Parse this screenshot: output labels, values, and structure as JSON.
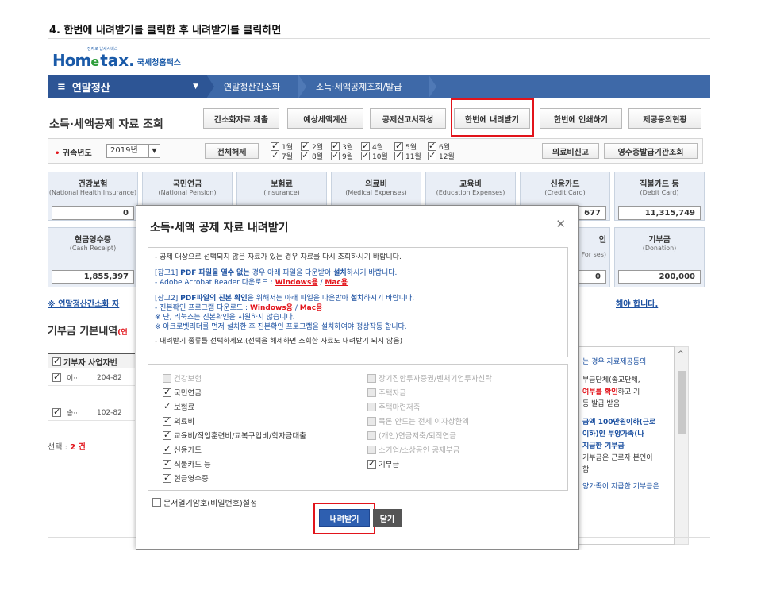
{
  "step_title": "4. 한번에 내려받기를 클릭한 후 내려받기를 클릭하면",
  "logo": {
    "home": "Hom",
    "e": "e",
    "tax": "tax.",
    "kr": "국세청홈택스",
    "small": "전자로 납세서비스"
  },
  "nav": {
    "menu_icon": "≡",
    "main": "연말정산",
    "dropdown_icon": "▼",
    "crumbs": [
      "연말정산간소화",
      "소득·세액공제조회/발급"
    ]
  },
  "page_title": "소득·세액공제 자료 조회",
  "toolbar": [
    "간소화자료 제출",
    "예상세액계산",
    "공제신고서작성",
    "한번에 내려받기",
    "한번에 인쇄하기",
    "제공동의현황"
  ],
  "filter": {
    "label_star": "•",
    "label": "귀속년도",
    "year": "2019년",
    "arrow": "▼",
    "clear_all": "전체해제",
    "months_top": [
      "1월",
      "2월",
      "3월",
      "4월",
      "5월",
      "6월"
    ],
    "months_bottom": [
      "7월",
      "8월",
      "9월",
      "10월",
      "11월",
      "12월"
    ],
    "medical_report": "의료비신고",
    "receipt_lookup": "영수증발급기관조회"
  },
  "cards_row1": [
    {
      "title": "건강보험",
      "sub": "(National Health Insurance)",
      "value": "0"
    },
    {
      "title": "국민연금",
      "sub": "(National Pension)",
      "value": ""
    },
    {
      "title": "보험료",
      "sub": "(Insurance)",
      "value": ""
    },
    {
      "title": "의료비",
      "sub": "(Medical Expenses)",
      "value": ""
    },
    {
      "title": "교육비",
      "sub": "(Education Expenses)",
      "value": ""
    },
    {
      "title": "신용카드",
      "sub": "(Credit Card)",
      "value": "677"
    },
    {
      "title": "직불카드 등",
      "sub": "(Debit Card)",
      "value": "11,315,749"
    }
  ],
  "cards_row2": [
    {
      "title": "현금영수증",
      "sub": "(Cash Receipt)",
      "value": "1,855,397"
    },
    {
      "title": "인",
      "sub": "For ses)",
      "value": "0"
    },
    {
      "title": "기부금",
      "sub": "(Donation)",
      "value": "200,000"
    }
  ],
  "note_link": "※ 연말정산간소화 자",
  "note_link_right": "해야 합니다.",
  "donation": {
    "title": "기부금 기본내역",
    "title_red": "(연",
    "header": "기부자 사업자번",
    "rows": [
      {
        "name": "이···",
        "biz": "204-82"
      },
      {
        "name": "송···",
        "biz": "102-82"
      }
    ],
    "selected_label": "선택 : ",
    "selected_count": "2 건"
  },
  "side_notes": {
    "l1": "는 경우 자료제공동의",
    "l2": "부금단체(종교단체,",
    "l3a": "여부를 확인",
    "l3b": "하고 기",
    "l4": "등 발급 받음",
    "l5": "금액 100만원이하(근로",
    "l6": "이하)인 부양가족(나",
    "l7": "지급한 기부금",
    "l8": "기부금은 근로자 본인이",
    "l9": "함",
    "l10": "양가족이 지급한 기부금은",
    "up_icon": "^"
  },
  "modal": {
    "title": "소득·세액 공제 자료 내려받기",
    "close_icon": "✕",
    "info": {
      "l1": "- 공제 대상으로 선택되지 않은 자료가 있는 경우 자료를 다시 조회하시기 바랍니다.",
      "n1a": "[참고1] ",
      "n1b": "PDF 파일을 열수 없는",
      "n1c": " 경우  아래 파일을 다운받아 ",
      "n1d": "설치",
      "n1e": "하시기 바랍니다.",
      "n2a": "- Adobe Acrobat Reader 다운로드 : ",
      "n2b": "Windows용",
      "n2c": " / ",
      "n2d": "Mac용",
      "n3a": "[참고2] ",
      "n3b": "PDF파일의 진본 확인",
      "n3c": "을 위해서는 아래 파일을 다운받아 ",
      "n3d": "설치",
      "n3e": "하시기 바랍니다.",
      "n4a": "- 진본확인 프로그램 다운로드 : ",
      "n4b": "Windows용",
      "n4c": " / ",
      "n4d": "Mac용",
      "n5": "※ 단, 리눅스는 진본확인을 지원하지 않습니다.",
      "n6": "※ 아크로벳리더를 먼저 설치한 후 진본확인 프로그램을 설치하여야 정상작동 합니다.",
      "l2": "- 내려받기 종류를 선택하세요.(선택을 해제하면 조회한 자료도 내려받기 되지 않음)"
    },
    "left_options": [
      {
        "label": "건강보험",
        "checked": false,
        "disabled": true
      },
      {
        "label": "국민연금",
        "checked": true,
        "disabled": false
      },
      {
        "label": "보험료",
        "checked": true,
        "disabled": false
      },
      {
        "label": "의료비",
        "checked": true,
        "disabled": false
      },
      {
        "label": "교육비/직업훈련비/교복구입비/학자금대출",
        "checked": true,
        "disabled": false
      },
      {
        "label": "신용카드",
        "checked": true,
        "disabled": false
      },
      {
        "label": "직불카드 등",
        "checked": true,
        "disabled": false
      },
      {
        "label": "현금영수증",
        "checked": true,
        "disabled": false
      }
    ],
    "right_options": [
      {
        "label": "장기집합투자증권/벤처기업투자신탁",
        "checked": false,
        "disabled": true
      },
      {
        "label": "주택자금",
        "checked": false,
        "disabled": true
      },
      {
        "label": "주택마련저축",
        "checked": false,
        "disabled": true
      },
      {
        "label": "목돈 안드는 전세 이자상환액",
        "checked": false,
        "disabled": true
      },
      {
        "label": "(개인)연금저축/퇴직연금",
        "checked": false,
        "disabled": true
      },
      {
        "label": "소기업/소상공인 공제부금",
        "checked": false,
        "disabled": true
      },
      {
        "label": "기부금",
        "checked": true,
        "disabled": false
      }
    ],
    "password_option": "문서열기암호(비밀번호)설정",
    "download_button": "내려받기",
    "close_button": "닫기"
  },
  "colors": {
    "nav": "#3e69a8",
    "highlight": "#e2141b",
    "primary_button": "#2e5fb0"
  }
}
